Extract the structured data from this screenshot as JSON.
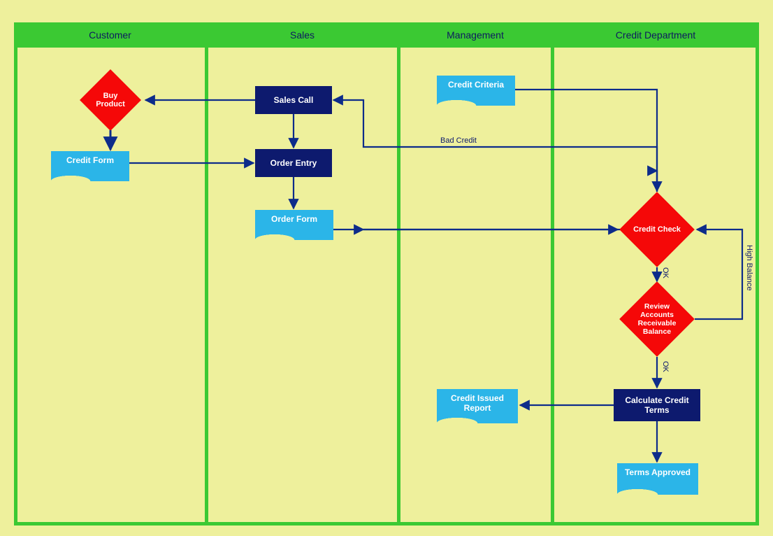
{
  "lanes": {
    "customer": "Customer",
    "sales": "Sales",
    "management": "Management",
    "credit_dept": "Credit Department"
  },
  "nodes": {
    "buy_product": "Buy Product",
    "credit_form": "Credit Form",
    "sales_call": "Sales Call",
    "order_entry": "Order Entry",
    "order_form": "Order Form",
    "credit_criteria": "Credit Criteria",
    "credit_check": "Credit Check",
    "review_accounts": "Review Accounts Receivable Balance",
    "calculate_terms": "Calculate Credit Terms",
    "credit_issued_report": "Credit Issued Report",
    "terms_approved": "Terms Approved"
  },
  "edge_labels": {
    "bad_credit": "Bad Credit",
    "ok1": "OK",
    "ok2": "OK",
    "high_balance": "High Balance"
  },
  "colors": {
    "lane_header": "#3bc933",
    "lane_bg": "#eef09c",
    "process": "#0d1a6e",
    "decision": "#f50808",
    "document": "#2bb5e8",
    "arrow": "#0d2c8a"
  }
}
